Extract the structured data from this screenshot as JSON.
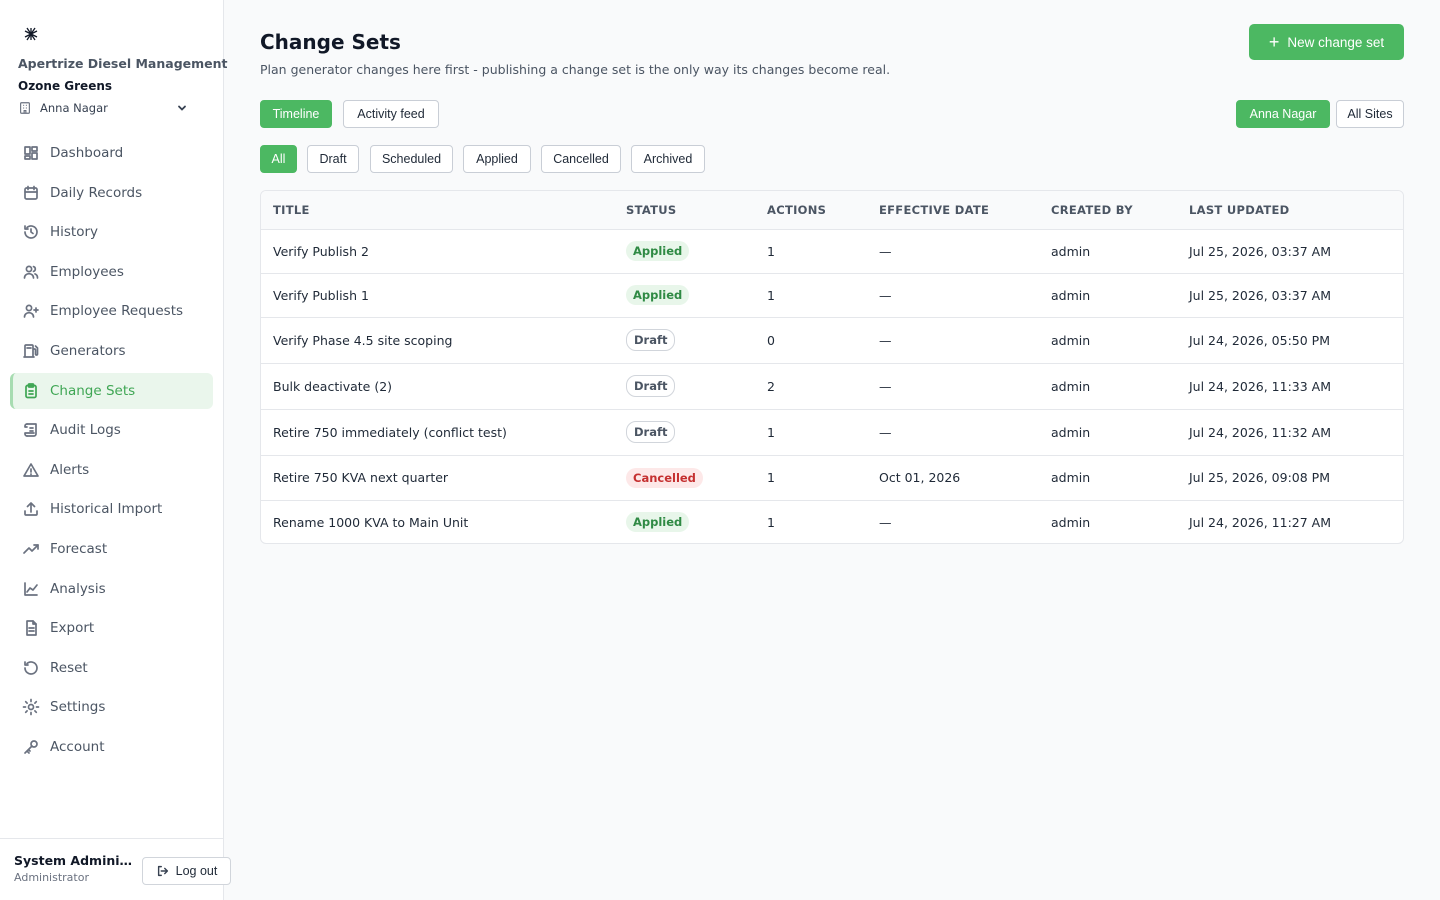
{
  "sidebar": {
    "app_name": "Apertrize Diesel Management",
    "org_name": "Ozone Greens",
    "site_selector": "Anna Nagar",
    "items": [
      {
        "label": "Dashboard",
        "icon": "grid-icon"
      },
      {
        "label": "Daily Records",
        "icon": "calendar-icon"
      },
      {
        "label": "History",
        "icon": "history-icon"
      },
      {
        "label": "Employees",
        "icon": "users-icon"
      },
      {
        "label": "Employee Requests",
        "icon": "user-plus-icon"
      },
      {
        "label": "Generators",
        "icon": "fuel-icon"
      },
      {
        "label": "Change Sets",
        "icon": "clipboard-icon",
        "active": true
      },
      {
        "label": "Audit Logs",
        "icon": "scroll-icon"
      },
      {
        "label": "Alerts",
        "icon": "alert-triangle-icon"
      },
      {
        "label": "Historical Import",
        "icon": "upload-icon"
      },
      {
        "label": "Forecast",
        "icon": "trending-up-icon"
      },
      {
        "label": "Analysis",
        "icon": "line-chart-icon"
      },
      {
        "label": "Export",
        "icon": "file-icon"
      },
      {
        "label": "Reset",
        "icon": "rotate-ccw-icon"
      },
      {
        "label": "Settings",
        "icon": "gear-icon"
      },
      {
        "label": "Account",
        "icon": "key-icon"
      }
    ],
    "user_name": "System Administ...",
    "user_role": "Administrator",
    "logout_label": "Log out"
  },
  "header": {
    "title": "Change Sets",
    "subtitle": "Plan generator changes here first - publishing a change set is the only way its changes become real.",
    "new_button": "New change set"
  },
  "views": {
    "timeline": "Timeline",
    "activity": "Activity feed",
    "active": "Timeline"
  },
  "scope": {
    "site": "Anna Nagar",
    "all_sites": "All Sites",
    "active": "Anna Nagar"
  },
  "filters": {
    "all": "All",
    "draft": "Draft",
    "scheduled": "Scheduled",
    "applied": "Applied",
    "cancelled": "Cancelled",
    "archived": "Archived",
    "active": "All"
  },
  "table": {
    "columns": [
      "TITLE",
      "STATUS",
      "ACTIONS",
      "EFFECTIVE DATE",
      "CREATED BY",
      "LAST UPDATED"
    ],
    "rows": [
      {
        "title": "Verify Publish 2",
        "status": "Applied",
        "actions": "1",
        "effective": "—",
        "created_by": "admin",
        "updated": "Jul 25, 2026, 03:37 AM"
      },
      {
        "title": "Verify Publish 1",
        "status": "Applied",
        "actions": "1",
        "effective": "—",
        "created_by": "admin",
        "updated": "Jul 25, 2026, 03:37 AM"
      },
      {
        "title": "Verify Phase 4.5 site scoping",
        "status": "Draft",
        "actions": "0",
        "effective": "—",
        "created_by": "admin",
        "updated": "Jul 24, 2026, 05:50 PM"
      },
      {
        "title": "Bulk deactivate (2)",
        "status": "Draft",
        "actions": "2",
        "effective": "—",
        "created_by": "admin",
        "updated": "Jul 24, 2026, 11:33 AM"
      },
      {
        "title": "Retire 750 immediately (conflict test)",
        "status": "Draft",
        "actions": "1",
        "effective": "—",
        "created_by": "admin",
        "updated": "Jul 24, 2026, 11:32 AM"
      },
      {
        "title": "Retire 750 KVA next quarter",
        "status": "Cancelled",
        "actions": "1",
        "effective": "Oct 01, 2026",
        "created_by": "admin",
        "updated": "Jul 25, 2026, 09:08 PM"
      },
      {
        "title": "Rename 1000 KVA to Main Unit",
        "status": "Applied",
        "actions": "1",
        "effective": "—",
        "created_by": "admin",
        "updated": "Jul 24, 2026, 11:27 AM"
      }
    ]
  },
  "colors": {
    "accent": "#4cb862",
    "active_nav_bg": "#eaf6ec",
    "applied": "#2f8a44",
    "cancelled": "#c53030"
  }
}
